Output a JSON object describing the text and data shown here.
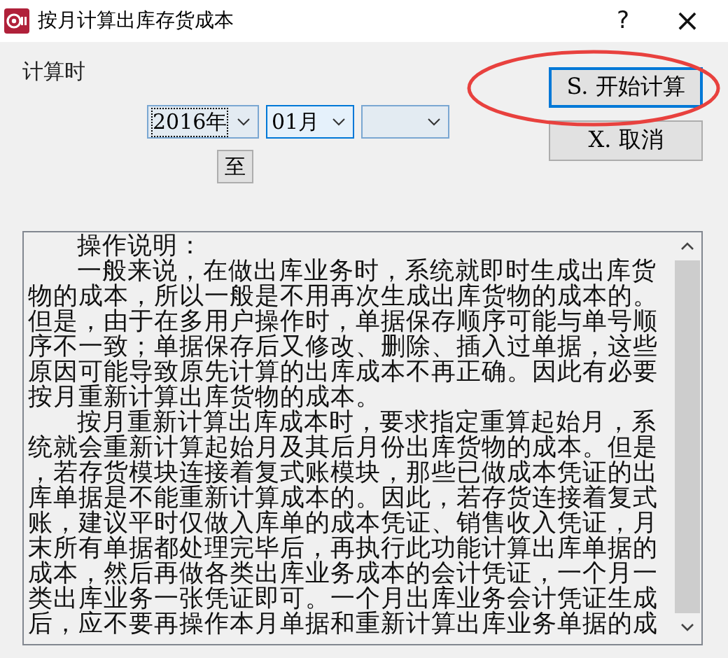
{
  "window": {
    "title": "按月计算出库存货成本",
    "help": "?",
    "close": "×"
  },
  "period": {
    "label": "计算时",
    "combos": [
      {
        "value": "2016年",
        "focused": true
      },
      {
        "value": "01月",
        "focused": false
      },
      {
        "focused": false
      }
    ],
    "to_button": "至"
  },
  "buttons": [
    {
      "label": "S. 开始计算",
      "default": true
    },
    {
      "label": "X. 取消",
      "default": false
    }
  ],
  "instructions": {
    "lines": [
      {
        "text": "操作说明：",
        "indent": true
      },
      {
        "text": "一般来说，在做出库业务时，系统就即时生成出库货",
        "indent": true
      },
      {
        "text": "物的成本，所以一般是不用再次生成出库货物的成本的。",
        "indent": false
      },
      {
        "text": "但是，由于在多用户操作时，单据保存顺序可能与单号顺",
        "indent": false
      },
      {
        "text": "序不一致；单据保存后又修改、删除、插入过单据，这些",
        "indent": false
      },
      {
        "text": "原因可能导致原先计算的出库成本不再正确。因此有必要",
        "indent": false
      },
      {
        "text": "按月重新计算出库货物的成本。",
        "indent": false
      },
      {
        "text": "按月重新计算出库成本时，要求指定重算起始月，系",
        "indent": true
      },
      {
        "text": "统就会重新计算起始月及其后月份出库货物的成本。但是",
        "indent": false
      },
      {
        "text": "，若存货模块连接着复式账模块，那些已做成本凭证的出",
        "indent": false
      },
      {
        "text": "库单据是不能重新计算成本的。因此，若存货连接着复式",
        "indent": false
      },
      {
        "text": "账，建议平时仅做入库单的成本凭证、销售收入凭证，月",
        "indent": false
      },
      {
        "text": "末所有单据都处理完毕后，再执行此功能计算出库单据的",
        "indent": false
      },
      {
        "text": "成本，然后再做各类出库业务成本的会计凭证，一个月一",
        "indent": false
      },
      {
        "text": "类出库业务一张凭证即可。一个月出库业务会计凭证生成",
        "indent": false
      },
      {
        "text": "后，应不要再操作本月单据和重新计算出库业务单据的成",
        "indent": false
      }
    ]
  }
}
